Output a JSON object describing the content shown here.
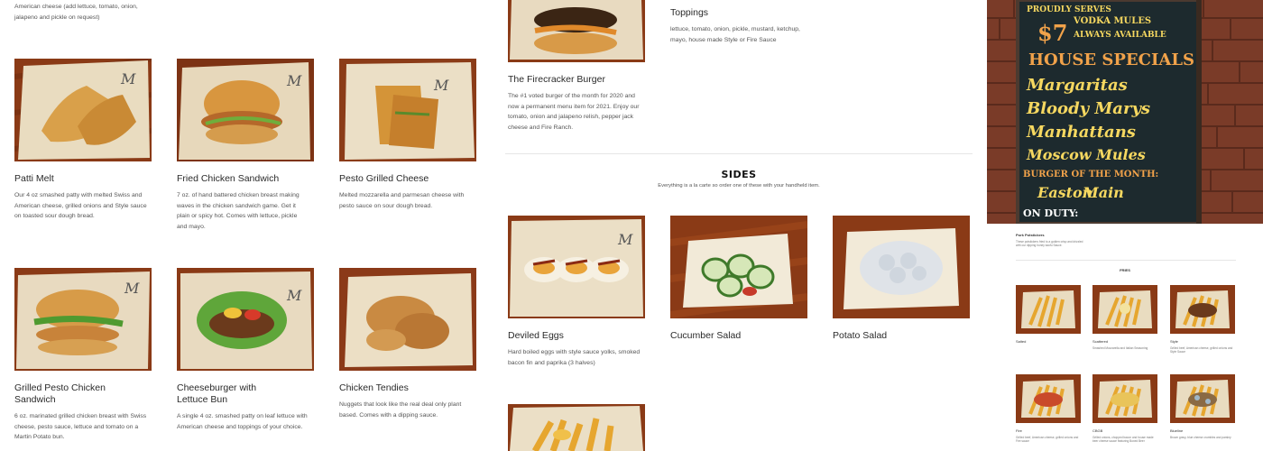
{
  "top_desc_fragment": "American cheese (add lettuce, tomato, onion, jalapeno and pickle on request)",
  "items": [
    {
      "title": "Patti Melt",
      "desc": "Our 4 oz smashed patty with melted Swiss and American cheese, grilled onions and Style sauce on toasted sour dough bread."
    },
    {
      "title": "Fried Chicken Sandwich",
      "desc": "7 oz. of hand battered chicken breast making waves in the chicken sandwich game. Get it plain or spicy hot.  Comes with lettuce, pickle and mayo."
    },
    {
      "title": "Pesto Grilled Cheese",
      "desc": "Melted mozzarella and parmesan cheese with pesto sauce on sour dough bread."
    },
    {
      "title": "Grilled Pesto Chicken Sandwich",
      "desc": "6 oz. marinated grilled chicken breast with Swiss cheese, pesto sauce, lettuce and tomato on a Martin Potato bun."
    },
    {
      "title": "Cheeseburger with Lettuce Bun",
      "desc": "A single 4 oz. smashed patty on leaf lettuce with American cheese and toppings of your choice."
    },
    {
      "title": "Chicken Tendies",
      "desc": "Nuggets that look like the real deal only plant based. Comes with a dipping sauce."
    }
  ],
  "firecracker": {
    "title": "The Firecracker Burger",
    "desc": "The #1 voted burger of the month for 2020 and now a permanent menu item for 2021. Enjoy our tomato, onion and jalapeno relish, pepper jack cheese and Fire Ranch."
  },
  "toppings": {
    "title": "Toppings",
    "desc": "lettuce, tomato, onion, pickle, mustard, ketchup, mayo, house made Style or Fire Sauce"
  },
  "sides": {
    "title": "SIDES",
    "subtitle": "Everything is a la carte so order one of these with your handheld item.",
    "items": [
      {
        "title": "Deviled Eggs",
        "desc": "Hard boiled eggs with style sauce yolks, smoked bacon fin and paprika (3 halves)"
      },
      {
        "title": "Cucumber Salad",
        "desc": ""
      },
      {
        "title": "Potato Salad",
        "desc": ""
      }
    ]
  },
  "chalkboard": {
    "lines": [
      "PROUDLY SERVES",
      "$7",
      "VODKA MULES",
      "ALWAYS AVAILABLE",
      "HOUSE SPECIALS",
      "Margaritas",
      "Bloody Marys",
      "Manhattans",
      "Moscow Mules",
      "BURGER OF THE MONTH:",
      "Easton",
      "Main",
      "ON DUTY:"
    ]
  },
  "mini_page": {
    "pork_title": "Pork Potstickers",
    "pork_desc": "These potstickers fried to a golden crisp and drizzled with our dipping honey kaofu Sauce.",
    "fries_title": "FRIES",
    "fries": [
      {
        "label": "Salted",
        "desc": ""
      },
      {
        "label": "Scattered",
        "desc": "Smashed Mozzarella and Italian Seasoning"
      },
      {
        "label": "Style",
        "desc": "Grilled beef, American cheese, grilled onions and Style Sauce"
      },
      {
        "label": "Fire",
        "desc": "Grilled beef, American cheese, grilled onions and Fire sauce"
      },
      {
        "label": "CBGB",
        "desc": "Grilled onions, chopped bacon and house made beer cheese sauce featuring Boxed Beer"
      },
      {
        "label": "Blueline",
        "desc": "Brown gravy, blue cheese crumbles and parsley"
      }
    ]
  },
  "colors": {
    "wood": "#8a3a16",
    "paper": "#e9dcc0",
    "chalk": "#1d2a2e",
    "brick": "#7a3b28",
    "chalk_orange": "#f1a24a",
    "chalk_yellow": "#f6d860"
  }
}
